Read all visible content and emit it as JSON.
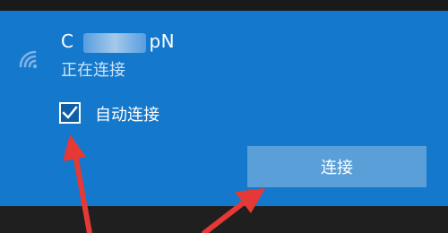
{
  "network": {
    "name_start": "C",
    "name_end": "pN",
    "status": "正在连接",
    "icon": "wifi-icon"
  },
  "auto_connect": {
    "label": "自动连接",
    "checked": true,
    "icon": "checkmark-icon"
  },
  "connect_button": {
    "label": "连接"
  },
  "colors": {
    "panel": "#1478cc",
    "button": "#5a9fd8",
    "annotation_arrow": "#e53935"
  }
}
